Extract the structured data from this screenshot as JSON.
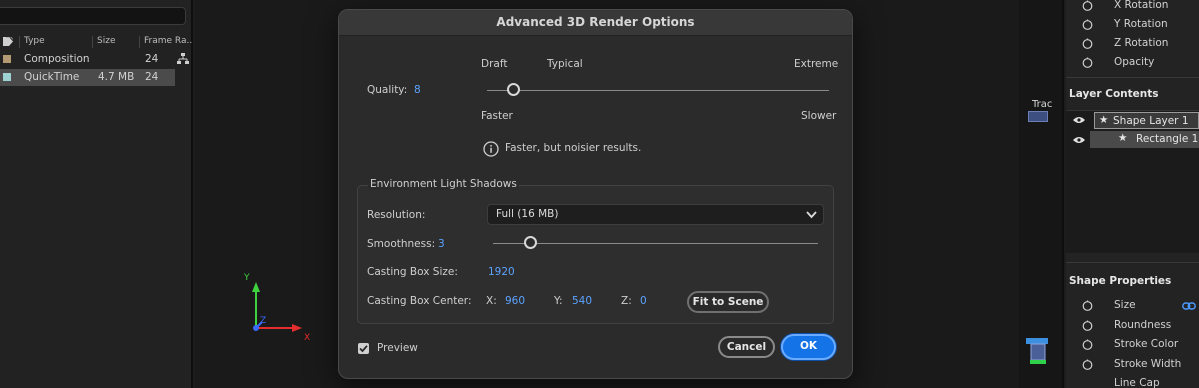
{
  "project": {
    "columns": [
      "Type",
      "Size",
      "Frame Ra.."
    ],
    "rows": [
      {
        "type": "Composition",
        "size": "",
        "frame_rate": "24",
        "color": "#b59a73"
      },
      {
        "type": "QuickTime",
        "size": "4.7 MB",
        "frame_rate": "24",
        "color": "#9fd3d3"
      }
    ]
  },
  "timeline": {
    "track_label": "Trac"
  },
  "viewer": {
    "axis_x": "X",
    "axis_y": "Y",
    "axis_z": "Z"
  },
  "transform_props": [
    "X Rotation",
    "Y Rotation",
    "Z Rotation",
    "Opacity"
  ],
  "layer_contents": {
    "title": "Layer Contents",
    "items": [
      "Shape Layer 1",
      "Rectangle 1"
    ]
  },
  "shape_properties": {
    "title": "Shape Properties",
    "items": [
      "Size",
      "Roundness",
      "Stroke Color",
      "Stroke Width",
      "Line Cap"
    ]
  },
  "dialog": {
    "title": "Advanced 3D Render Options",
    "quality": {
      "label": "Quality:",
      "value": "8",
      "left_top": "Draft",
      "mid_top": "Typical",
      "right_top": "Extreme",
      "left_bottom": "Faster",
      "right_bottom": "Slower",
      "slider_fraction": 0.06
    },
    "info_text": "Faster, but noisier results.",
    "env_group": {
      "title": "Environment Light Shadows",
      "resolution_label": "Resolution:",
      "resolution_value": "Full (16 MB)",
      "smoothness_label": "Smoothness:",
      "smoothness_value": "3",
      "smoothness_fraction": 0.1,
      "box_size_label": "Casting Box Size:",
      "box_size_value": "1920",
      "box_center_label": "Casting Box Center:",
      "x_label": "X:",
      "x_value": "960",
      "y_label": "Y:",
      "y_value": "540",
      "z_label": "Z:",
      "z_value": "0",
      "fit_button": "Fit to Scene"
    },
    "preview_label": "Preview",
    "preview_checked": true,
    "cancel_button": "Cancel",
    "ok_button": "OK"
  }
}
